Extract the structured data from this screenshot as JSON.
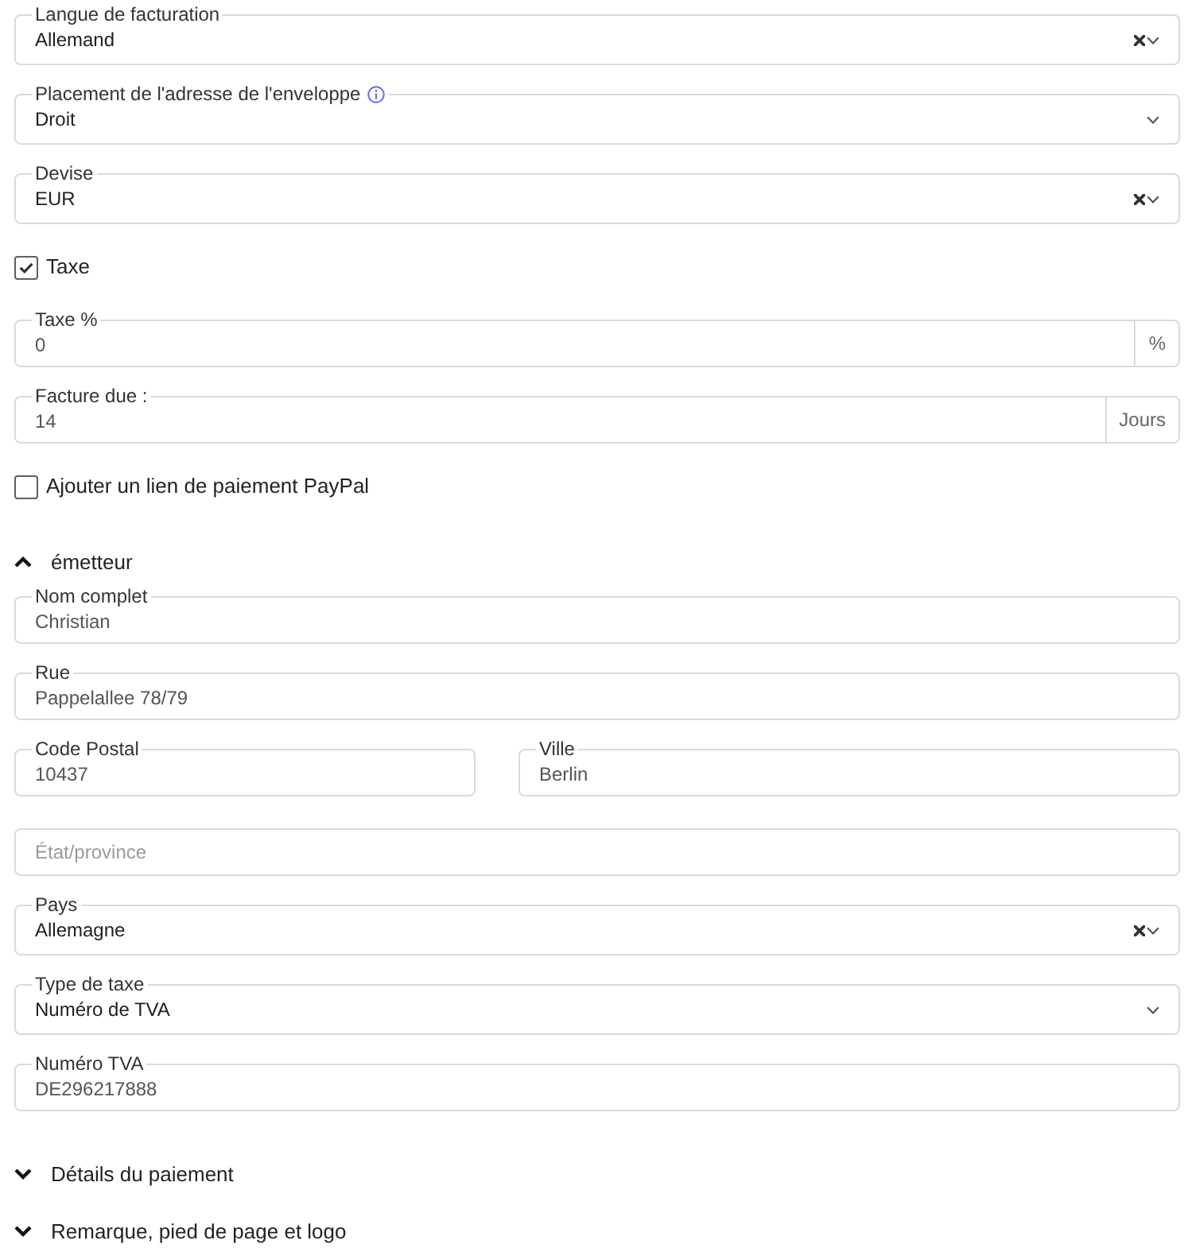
{
  "form": [
    {
      "kind": "select",
      "label": "Langue de facturation",
      "value": "Allemand",
      "clearable": true
    },
    {
      "kind": "select",
      "label": "Placement de l'adresse de l'enveloppe",
      "info": true,
      "value": "Droit",
      "clearable": false
    },
    {
      "kind": "select",
      "label": "Devise",
      "value": "EUR",
      "clearable": true
    },
    {
      "kind": "checkbox",
      "label": "Taxe",
      "checked": true
    },
    {
      "kind": "input",
      "label": "Taxe %",
      "value": "0",
      "unit": "%"
    },
    {
      "kind": "input",
      "label": "Facture due :",
      "value": "14",
      "unit": "Jours"
    },
    {
      "kind": "checkbox",
      "label": "Ajouter un lien de paiement PayPal",
      "checked": false
    },
    {
      "kind": "section",
      "title": "émetteur",
      "expanded": true,
      "children": [
        {
          "kind": "input",
          "label": "Nom complet",
          "value": "Christian"
        },
        {
          "kind": "input",
          "label": "Rue",
          "value": "Pappelallee 78/79"
        },
        {
          "kind": "row",
          "fields": [
            {
              "kind": "input",
              "label": "Code Postal",
              "value": "10437"
            },
            {
              "kind": "input",
              "label": "Ville",
              "value": "Berlin"
            }
          ]
        },
        {
          "kind": "input",
          "placeholder": "État/province"
        },
        {
          "kind": "select",
          "label": "Pays",
          "value": "Allemagne",
          "clearable": true
        },
        {
          "kind": "select",
          "label": "Type de taxe",
          "value": "Numéro de TVA",
          "clearable": false
        },
        {
          "kind": "input",
          "label": "Numéro TVA",
          "value": "DE296217888"
        }
      ]
    },
    {
      "kind": "section",
      "title": "Détails du paiement",
      "expanded": false
    },
    {
      "kind": "section",
      "title": "Remarque, pied de page et logo",
      "expanded": false
    }
  ]
}
